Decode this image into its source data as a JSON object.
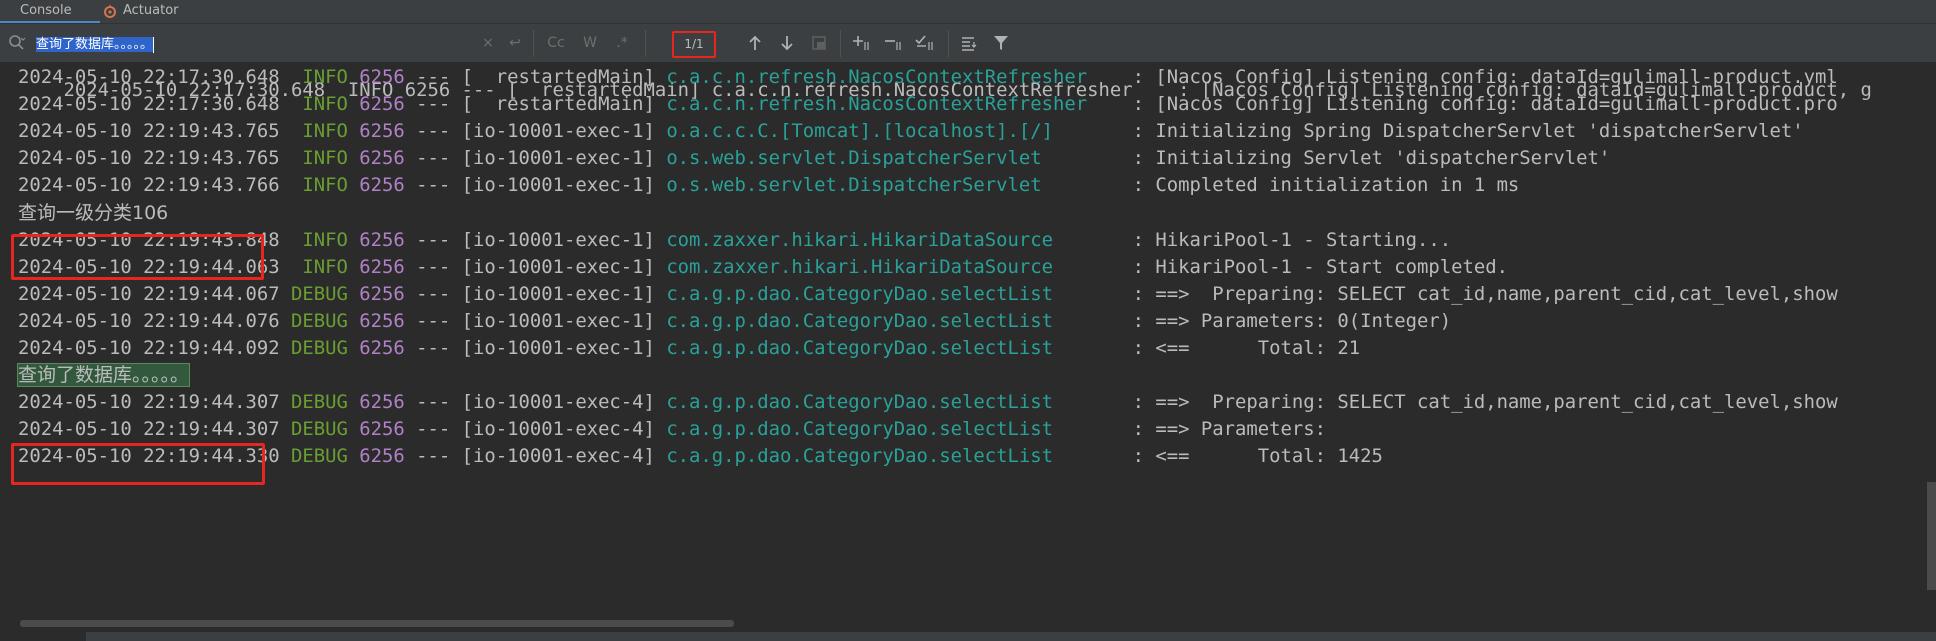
{
  "tabs": [
    {
      "label": "Console",
      "active": true
    },
    {
      "label": "Actuator",
      "active": false,
      "icon": "actuator-icon"
    }
  ],
  "search": {
    "query": "查询了数据库。。。。。",
    "match_count": "1/1",
    "controls": [
      "×",
      "↩",
      "Cc",
      "W",
      ".*"
    ]
  },
  "colors": {
    "info": "#6a9e33",
    "debug": "#6a9e33",
    "pid": "#b180c6",
    "logger": "#2aa198",
    "highlight_box": "#e8251f",
    "match_bg": "#32593d"
  },
  "log": {
    "partial_top": "2024-05-10 22:17:30.648  INFO 6256 --- [  restartedMain] c.a.c.n.refresh.NacosContextRefresher    : [Nacos Config] Listening config: dataId=gulimall-product, g",
    "lines": [
      {
        "ts": "2024-05-10 22:17:30.648",
        "level": " INFO",
        "pid": "6256",
        "thread": "--- [  restartedMain]",
        "logger": "c.a.c.n.refresh.NacosContextRefresher   ",
        "msg": " : [Nacos Config] Listening config: dataId=gulimall-product.yml"
      },
      {
        "ts": "2024-05-10 22:17:30.648",
        "level": " INFO",
        "pid": "6256",
        "thread": "--- [  restartedMain]",
        "logger": "c.a.c.n.refresh.NacosContextRefresher   ",
        "msg": " : [Nacos Config] Listening config: dataId=gulimall-product.pro"
      },
      {
        "ts": "2024-05-10 22:19:43.765",
        "level": " INFO",
        "pid": "6256",
        "thread": "--- [io-10001-exec-1]",
        "logger": "o.a.c.c.C.[Tomcat].[localhost].[/]      ",
        "msg": " : Initializing Spring DispatcherServlet 'dispatcherServlet'"
      },
      {
        "ts": "2024-05-10 22:19:43.765",
        "level": " INFO",
        "pid": "6256",
        "thread": "--- [io-10001-exec-1]",
        "logger": "o.s.web.servlet.DispatcherServlet       ",
        "msg": " : Initializing Servlet 'dispatcherServlet'"
      },
      {
        "ts": "2024-05-10 22:19:43.766",
        "level": " INFO",
        "pid": "6256",
        "thread": "--- [io-10001-exec-1]",
        "logger": "o.s.web.servlet.DispatcherServlet       ",
        "msg": " : Completed initialization in 1 ms"
      },
      {
        "plain": "查询一级分类106"
      },
      {
        "ts": "2024-05-10 22:19:43.848",
        "level": " INFO",
        "pid": "6256",
        "thread": "--- [io-10001-exec-1]",
        "logger": "com.zaxxer.hikari.HikariDataSource      ",
        "msg": " : HikariPool-1 - Starting..."
      },
      {
        "ts": "2024-05-10 22:19:44.063",
        "level": " INFO",
        "pid": "6256",
        "thread": "--- [io-10001-exec-1]",
        "logger": "com.zaxxer.hikari.HikariDataSource      ",
        "msg": " : HikariPool-1 - Start completed."
      },
      {
        "ts": "2024-05-10 22:19:44.067",
        "level": "DEBUG",
        "pid": "6256",
        "thread": "--- [io-10001-exec-1]",
        "logger": "c.a.g.p.dao.CategoryDao.selectList      ",
        "msg": " : ==>  Preparing: SELECT cat_id,name,parent_cid,cat_level,show"
      },
      {
        "ts": "2024-05-10 22:19:44.076",
        "level": "DEBUG",
        "pid": "6256",
        "thread": "--- [io-10001-exec-1]",
        "logger": "c.a.g.p.dao.CategoryDao.selectList      ",
        "msg": " : ==> Parameters: 0(Integer)"
      },
      {
        "ts": "2024-05-10 22:19:44.092",
        "level": "DEBUG",
        "pid": "6256",
        "thread": "--- [io-10001-exec-1]",
        "logger": "c.a.g.p.dao.CategoryDao.selectList      ",
        "msg": " : <==      Total: 21"
      },
      {
        "plain": "查询了数据库。。。。。",
        "found": true
      },
      {
        "ts": "2024-05-10 22:19:44.307",
        "level": "DEBUG",
        "pid": "6256",
        "thread": "--- [io-10001-exec-4]",
        "logger": "c.a.g.p.dao.CategoryDao.selectList      ",
        "msg": " : ==>  Preparing: SELECT cat_id,name,parent_cid,cat_level,show"
      },
      {
        "ts": "2024-05-10 22:19:44.307",
        "level": "DEBUG",
        "pid": "6256",
        "thread": "--- [io-10001-exec-4]",
        "logger": "c.a.g.p.dao.CategoryDao.selectList      ",
        "msg": " : ==> Parameters: "
      },
      {
        "ts": "2024-05-10 22:19:44.330",
        "level": "DEBUG",
        "pid": "6256",
        "thread": "--- [io-10001-exec-4]",
        "logger": "c.a.g.p.dao.CategoryDao.selectList      ",
        "msg": " : <==      Total: 1425"
      }
    ]
  }
}
